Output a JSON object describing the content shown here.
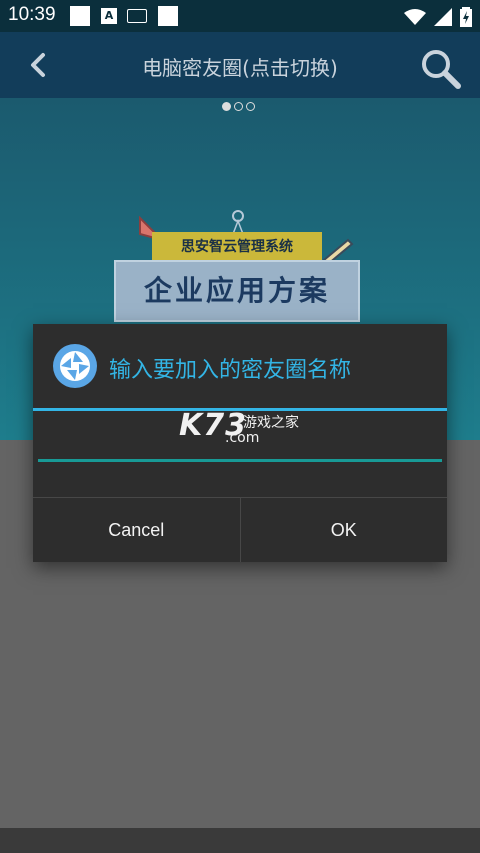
{
  "status_bar": {
    "time": "10:39",
    "notification_icons": [
      "square-icon",
      "a-icon",
      "keyboard-icon",
      "square-icon"
    ],
    "system_icons": [
      "wifi-icon",
      "signal-icon",
      "battery-charging-icon"
    ]
  },
  "app_bar": {
    "title": "电脑密友圈(点击切换)",
    "back_icon": "chevron-left-icon",
    "search_icon": "search-icon"
  },
  "banner": {
    "page_dots": 3,
    "active_dot": 0,
    "tag_text": "思安智云管理系统",
    "headline": "企业应用方案"
  },
  "dialog": {
    "title": "输入要加入的密友圈名称",
    "input_value": "",
    "watermark": {
      "logo": "K73",
      "cn_text": "游戏之家",
      "domain": ".com"
    },
    "cancel_label": "Cancel",
    "ok_label": "OK"
  },
  "colors": {
    "accent": "#33b5e5",
    "input_underline": "#189a96",
    "dialog_bg": "#2d2d2d",
    "appbar_bg": "#123d5a"
  }
}
